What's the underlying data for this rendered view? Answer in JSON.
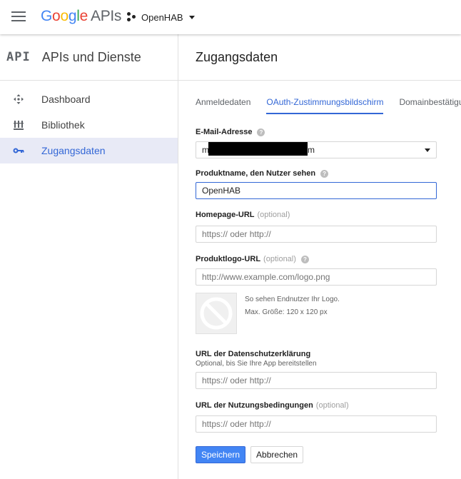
{
  "header": {
    "logo_google": "Google",
    "logo_apis": "APIs",
    "project_name": "OpenHAB"
  },
  "sidebar": {
    "badge": "API",
    "title": "APIs und Dienste",
    "items": [
      {
        "label": "Dashboard",
        "icon": "dashboard-icon"
      },
      {
        "label": "Bibliothek",
        "icon": "library-icon"
      },
      {
        "label": "Zugangsdaten",
        "icon": "key-icon"
      }
    ]
  },
  "main": {
    "title": "Zugangsdaten",
    "tabs": [
      {
        "label": "Anmeldedaten"
      },
      {
        "label": "OAuth-Zustimmungsbildschirm"
      },
      {
        "label": "Domainbestätigung"
      }
    ]
  },
  "form": {
    "email": {
      "label": "E-Mail-Adresse",
      "value_start": "m",
      "value_end": "m"
    },
    "product_name": {
      "label": "Produktname, den Nutzer sehen",
      "value": "OpenHAB"
    },
    "homepage": {
      "label": "Homepage-URL",
      "optional": "(optional)",
      "placeholder": "https:// oder http://"
    },
    "logo": {
      "label": "Produktlogo-URL",
      "optional": "(optional)",
      "placeholder": "http://www.example.com/logo.png",
      "hint_1": "So sehen Endnutzer Ihr Logo.",
      "hint_2": "Max. Größe: 120 x 120 px"
    },
    "privacy": {
      "label": "URL der Datenschutzerklärung",
      "sub": "Optional, bis Sie Ihre App bereitstellen",
      "placeholder": "https:// oder http://"
    },
    "terms": {
      "label": "URL der Nutzungsbedingungen",
      "optional": "(optional)",
      "placeholder": "https:// oder http://"
    },
    "save_label": "Speichern",
    "cancel_label": "Abbrechen"
  },
  "colors": {
    "accent": "#3367d6",
    "primary_button": "#4285f4",
    "active_nav_bg": "#e8eaf6"
  }
}
